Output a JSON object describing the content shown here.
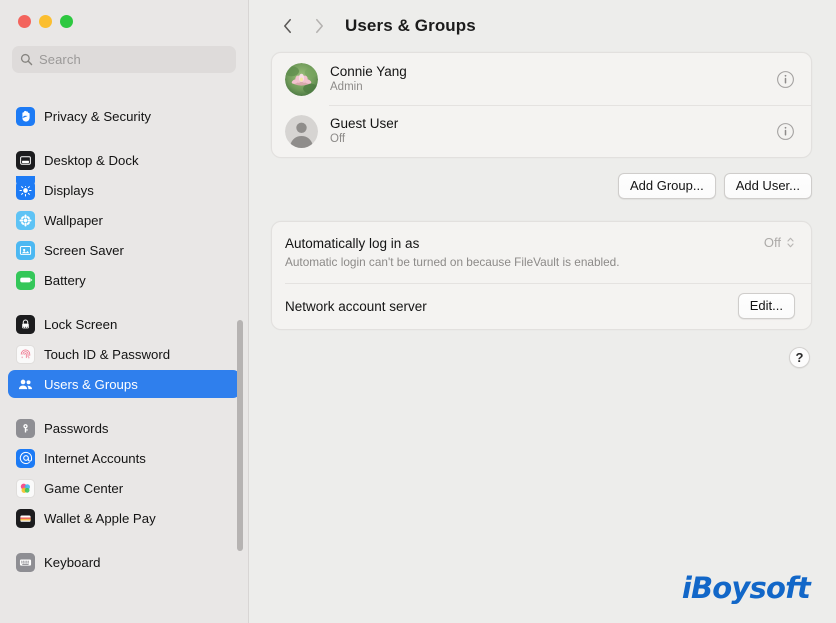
{
  "window": {
    "traffic_lights": [
      "close",
      "minimize",
      "zoom"
    ],
    "colors": {
      "close": "#f3645d",
      "minimize": "#fbbe2f",
      "zoom": "#2dc840",
      "accent": "#2f7fed",
      "watermark": "#1267c8"
    }
  },
  "sidebar": {
    "search": {
      "placeholder": "Search",
      "value": "",
      "icon": "search-icon"
    },
    "groups": [
      {
        "items": [
          {
            "label": "Privacy & Security",
            "icon": "hand-icon",
            "icon_bg": "#1d7bf5",
            "selected": false
          }
        ]
      },
      {
        "items": [
          {
            "label": "Desktop & Dock",
            "icon": "desktop-dock-icon",
            "icon_bg": "#1c1c1e",
            "selected": false
          },
          {
            "label": "Displays",
            "icon": "display-brightness-icon",
            "icon_bg": "#1d7bf5",
            "selected": false
          },
          {
            "label": "Wallpaper",
            "icon": "wallpaper-icon",
            "icon_bg": "#5ec3f5",
            "selected": false
          },
          {
            "label": "Screen Saver",
            "icon": "screen-saver-icon",
            "icon_bg": "#4cb8f2",
            "selected": false
          },
          {
            "label": "Battery",
            "icon": "battery-icon",
            "icon_bg": "#34c759",
            "selected": false
          }
        ]
      },
      {
        "items": [
          {
            "label": "Lock Screen",
            "icon": "lock-icon",
            "icon_bg": "#1c1c1e",
            "selected": false
          },
          {
            "label": "Touch ID & Password",
            "icon": "fingerprint-icon",
            "icon_bg": "#fafafa",
            "selected": false
          },
          {
            "label": "Users & Groups",
            "icon": "users-icon",
            "icon_bg": "#1d7bf5",
            "selected": true
          }
        ]
      },
      {
        "items": [
          {
            "label": "Passwords",
            "icon": "key-icon",
            "icon_bg": "#8e8e93",
            "selected": false
          },
          {
            "label": "Internet Accounts",
            "icon": "at-sign-icon",
            "icon_bg": "#1d7bf5",
            "selected": false
          },
          {
            "label": "Game Center",
            "icon": "game-center-icon",
            "icon_bg": "#fafafa",
            "selected": false
          },
          {
            "label": "Wallet & Apple Pay",
            "icon": "wallet-icon",
            "icon_bg": "#1c1c1e",
            "selected": false
          }
        ]
      },
      {
        "items": [
          {
            "label": "Keyboard",
            "icon": "keyboard-icon",
            "icon_bg": "#8e8e93",
            "selected": false
          }
        ]
      }
    ]
  },
  "toolbar": {
    "back_icon": "chevron-left-icon",
    "forward_icon": "chevron-right-icon",
    "title": "Users & Groups"
  },
  "users": [
    {
      "name": "Connie Yang",
      "role": "Admin",
      "avatar": "lotus-flower-photo",
      "info_icon": "info-icon"
    },
    {
      "name": "Guest User",
      "role": "Off",
      "avatar": "default-person-silhouette",
      "info_icon": "info-icon"
    }
  ],
  "actions": {
    "add_group": "Add Group...",
    "add_user": "Add User..."
  },
  "settings": {
    "auto_login": {
      "title": "Automatically log in as",
      "description": "Automatic login can't be turned on because FileVault is enabled.",
      "value": "Off",
      "control": "popup-stepper",
      "disabled": true
    },
    "network_account_server": {
      "title": "Network account server",
      "button": "Edit..."
    }
  },
  "help": {
    "label": "?",
    "icon": "question-mark-icon"
  },
  "branding": {
    "watermark": "iBoysoft"
  }
}
